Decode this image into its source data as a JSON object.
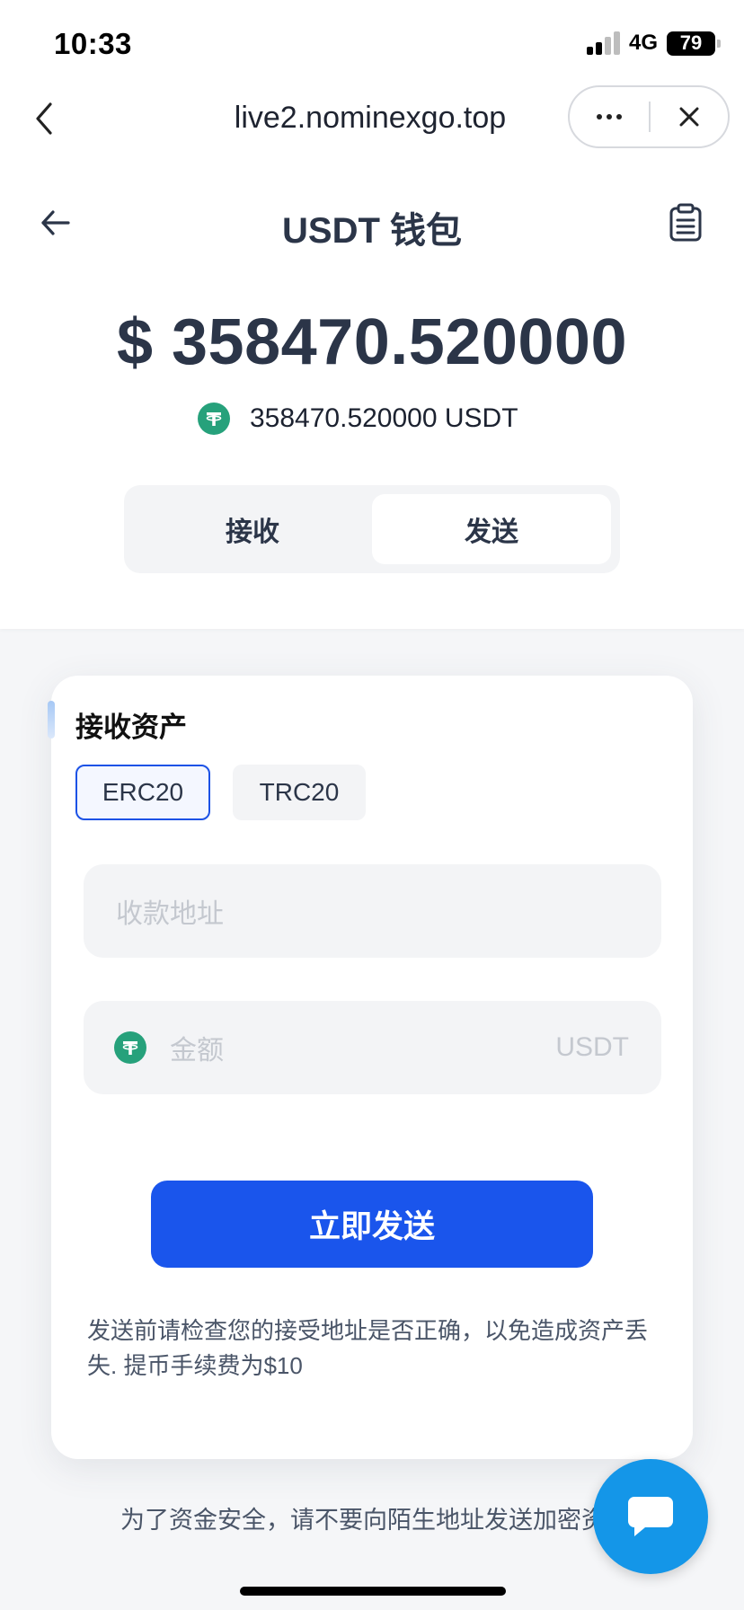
{
  "status_bar": {
    "time": "10:33",
    "network": "4G",
    "battery": "79"
  },
  "browser": {
    "url": "live2.nominexgo.top"
  },
  "header": {
    "title": "USDT 钱包"
  },
  "balance": {
    "main": "$ 358470.520000",
    "sub": "358470.520000 USDT"
  },
  "tabs": [
    {
      "label": "接收",
      "active": false
    },
    {
      "label": "发送",
      "active": true
    }
  ],
  "card": {
    "title": "接收资产",
    "networks": [
      {
        "label": "ERC20",
        "selected": true
      },
      {
        "label": "TRC20",
        "selected": false
      }
    ],
    "address_placeholder": "收款地址",
    "amount_placeholder": "金额",
    "amount_unit": "USDT",
    "send_button": "立即发送",
    "note": "发送前请检查您的接受地址是否正确，以免造成资产丢失. 提币手续费为$10"
  },
  "footer_note": "为了资金安全，请不要向陌生地址发送加密资",
  "colors": {
    "primary": "#1a55ec",
    "tether": "#26a17b",
    "chat": "#1496e8"
  }
}
